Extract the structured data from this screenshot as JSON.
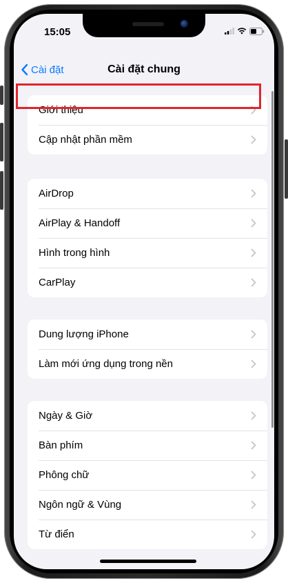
{
  "status_bar": {
    "time": "15:05"
  },
  "nav": {
    "back_label": "Cài đặt",
    "title": "Cài đặt chung"
  },
  "groups": [
    {
      "items": [
        "Giới thiệu",
        "Cập nhật phần mềm"
      ]
    },
    {
      "items": [
        "AirDrop",
        "AirPlay & Handoff",
        "Hình trong hình",
        "CarPlay"
      ]
    },
    {
      "items": [
        "Dung lượng iPhone",
        "Làm mới ứng dụng trong nền"
      ]
    },
    {
      "items": [
        "Ngày & Giờ",
        "Bàn phím",
        "Phông chữ",
        "Ngôn ngữ & Vùng",
        "Từ điển"
      ]
    }
  ],
  "colors": {
    "accent": "#0a7aff",
    "background": "#f2f2f7",
    "highlight": "#e0242b",
    "chevron": "#c4c4c7"
  },
  "icons": [
    "chevron-left-icon",
    "chevron-right-icon",
    "signal-icon",
    "wifi-icon",
    "battery-icon"
  ]
}
